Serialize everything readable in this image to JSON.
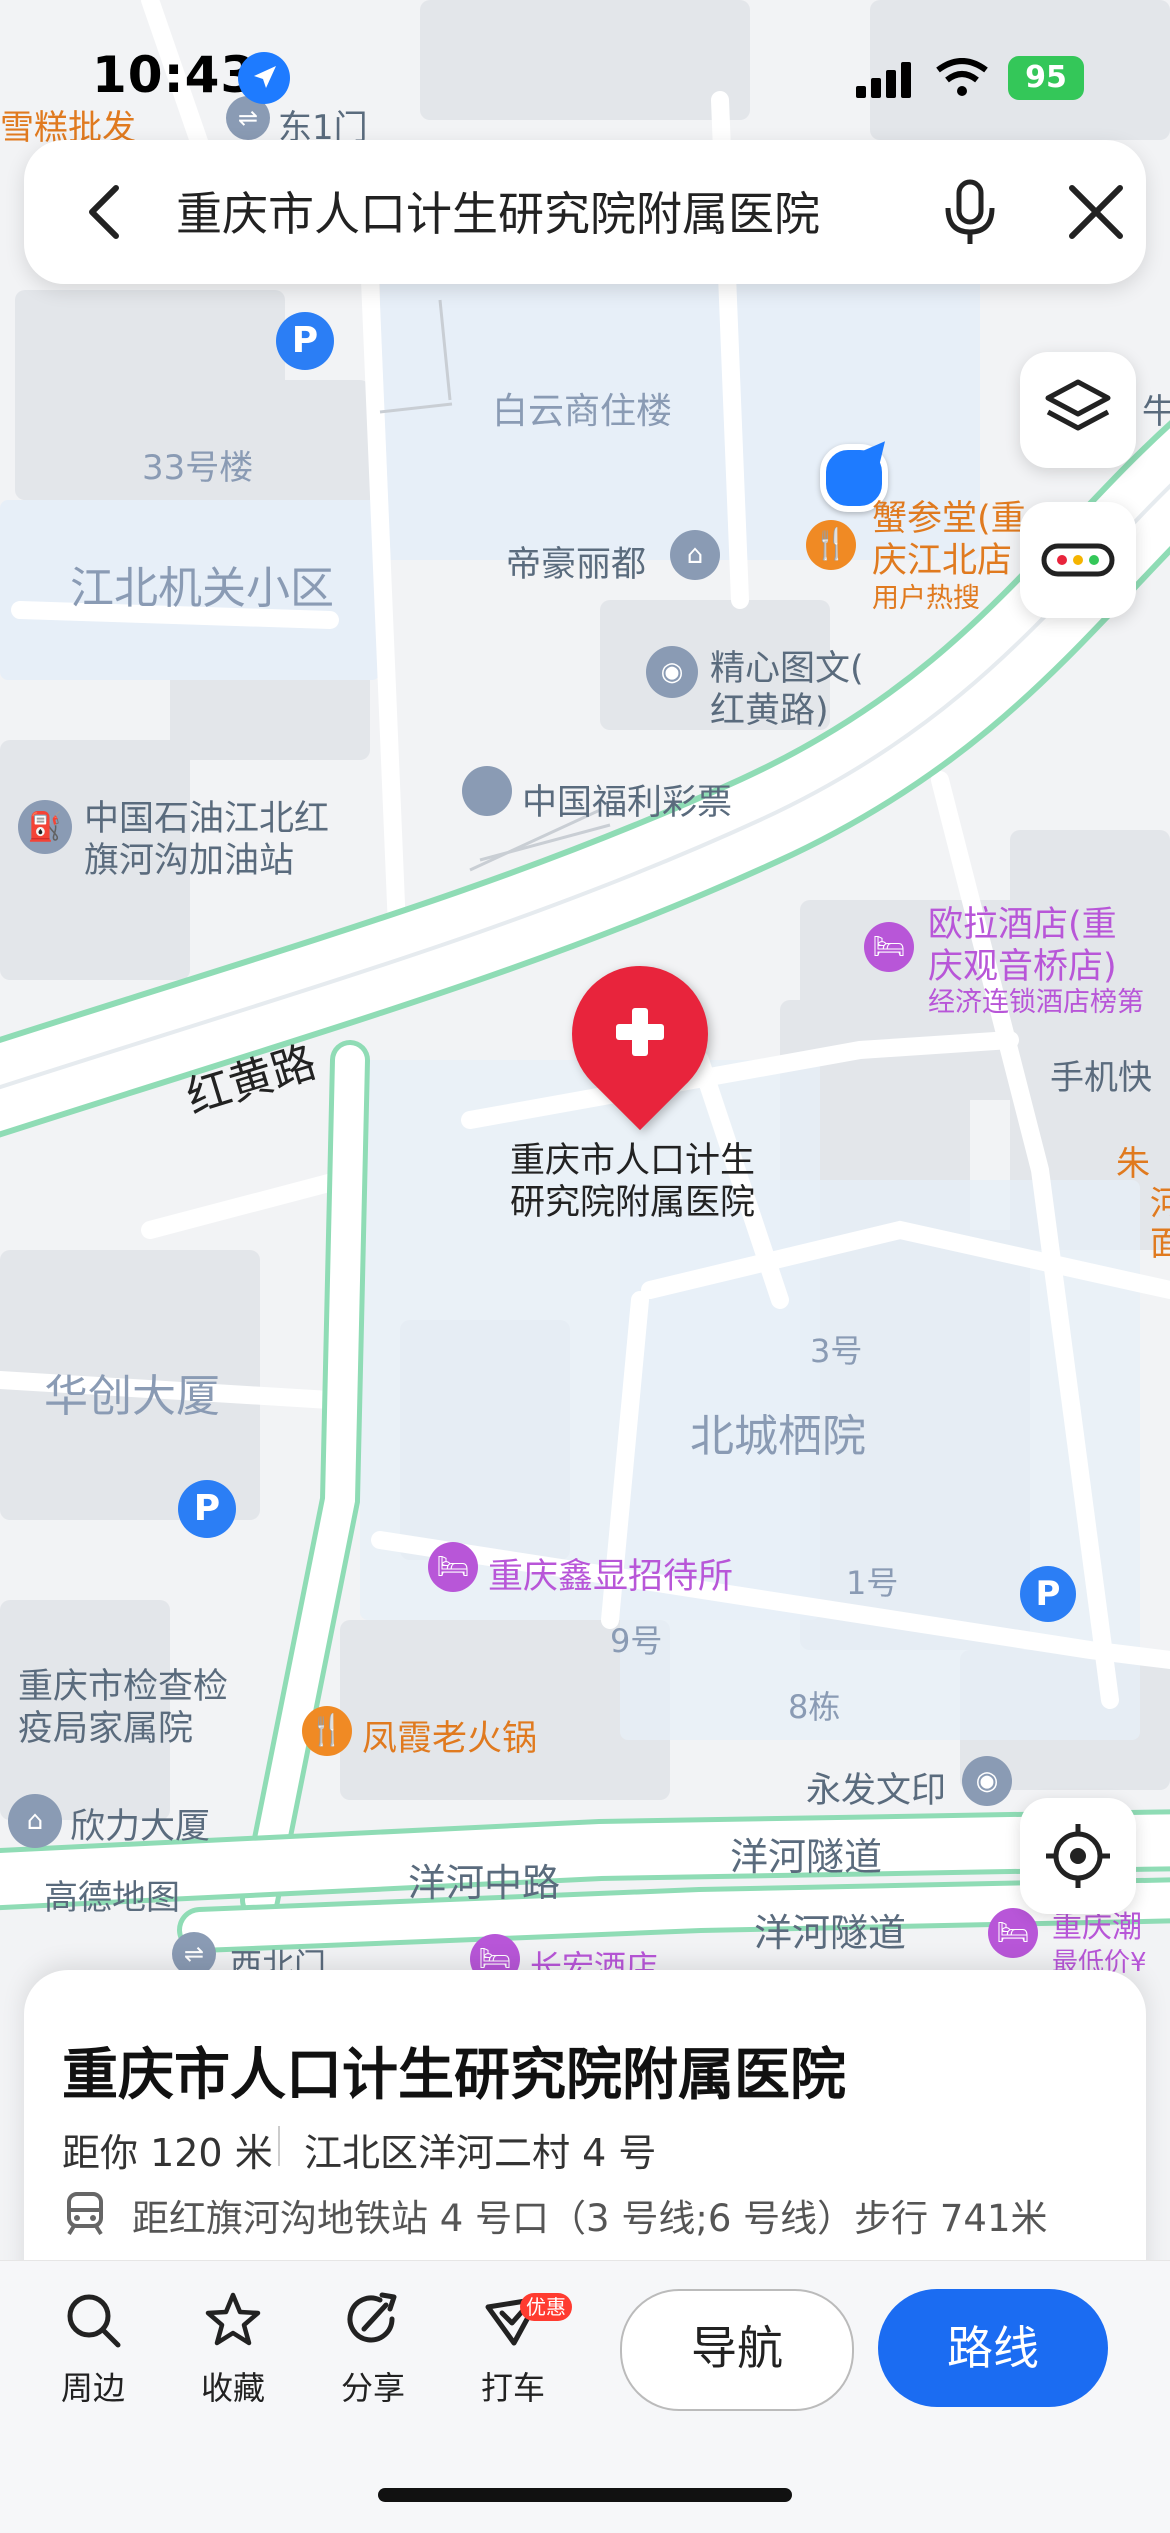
{
  "status_bar": {
    "time": "10:43",
    "battery": "95"
  },
  "search": {
    "query": "重庆市人口计生研究院附属医院"
  },
  "map": {
    "labels": {
      "xuegao": "雪糕批发",
      "dong1men": "东1门",
      "baiyun": "白云商住楼",
      "lou33": "33号楼",
      "jiguan": "江北机关小区",
      "dihao": "帝豪丽都",
      "xieshen1": "蟹参堂(重",
      "xieshen2": "庆江北店",
      "hot": "用户热搜",
      "jingxin1": "精心图文(",
      "jingxin2": "红黄路)",
      "petro1": "中国石油江北红",
      "petro2": "旗河沟加油站",
      "fuli": "中国福利彩票",
      "ola1": "欧拉酒店(重",
      "ola2": "庆观音桥店)",
      "ola3": "经济连锁酒店榜第",
      "phone": "手机快",
      "zhu1": "朱",
      "zhu2": "河",
      "zhu3": "面",
      "road_hh": "红黄路",
      "poi1": "重庆市人口计生",
      "poi2": "研究院附属医院",
      "huachuang": "华创大厦",
      "hao3": "3号",
      "beicheng": "北城栖院",
      "xinxian": "重庆鑫显招待所",
      "hao1": "1号",
      "hao9": "9号",
      "dong8": "8栋",
      "jianyi1": "重庆市检查检",
      "jianyi2": "疫局家属院",
      "fengxia": "凤霞老火锅",
      "yongfa": "永发文印",
      "xinli": "欣力大厦",
      "gaode": "高德地图",
      "yanghe_rd": "洋河中路",
      "tunnel1": "洋河隧道",
      "tunnel2": "洋河隧道",
      "chaoba1": "重庆潮",
      "chaoba2": "最低价¥",
      "xibeimen": "西北门",
      "changhong": "长宏酒店",
      "niu": "牛"
    }
  },
  "sheet": {
    "title": "重庆市人口计生研究院附属医院",
    "distance": "距你 120 米",
    "address": "江北区洋河二村 4 号",
    "metro": "距红旗河沟地铁站 4 号口（3 号线;6 号线）步行 741米"
  },
  "toolbar": {
    "nearby": "周边",
    "favorite": "收藏",
    "share": "分享",
    "taxi": "打车",
    "promo": "优惠",
    "navigate": "导航",
    "route": "路线"
  },
  "colors": {
    "accent": "#1b6cf2",
    "marker": "#e8243c",
    "road_stroke": "#8fdcb5",
    "poi_orange": "#f08a24",
    "poi_purple": "#b856d8"
  }
}
